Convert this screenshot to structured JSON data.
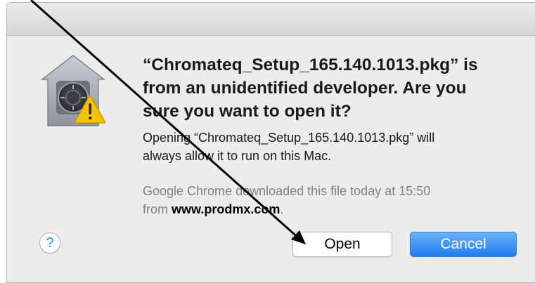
{
  "dialog": {
    "heading_lines": [
      "“Chromateq_Setup_165.140.1013.pkg” is",
      "from an unidentified developer. Are you",
      "sure you want to open it?"
    ],
    "info_lines": [
      "Opening “Chromateq_Setup_165.140.1013.pkg” will",
      "always allow it to run on this Mac."
    ],
    "source_line1": "Google Chrome downloaded this file today at 15:50",
    "source_prefix": "from ",
    "source_domain": "www.prodmx.com",
    "source_suffix": ".",
    "icon": "gatekeeper-security-warning-icon"
  },
  "buttons": {
    "help_label": "?",
    "open_label": "Open",
    "cancel_label": "Cancel"
  },
  "colors": {
    "dialog_bg": "#ececec",
    "cancel_button": "#1f7ef3",
    "help_accent": "#2d8cf0",
    "warning_yellow": "#f5c400"
  }
}
